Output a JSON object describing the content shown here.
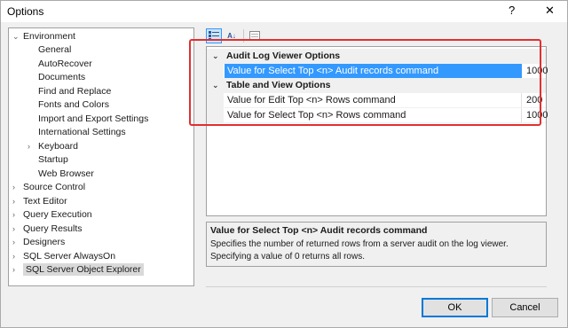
{
  "window": {
    "title": "Options",
    "help_glyph": "?",
    "close_glyph": "✕"
  },
  "tree": {
    "items": [
      {
        "label": "Environment",
        "glyph": "⌄"
      },
      {
        "label": "General",
        "glyph": ""
      },
      {
        "label": "AutoRecover",
        "glyph": ""
      },
      {
        "label": "Documents",
        "glyph": ""
      },
      {
        "label": "Find and Replace",
        "glyph": ""
      },
      {
        "label": "Fonts and Colors",
        "glyph": ""
      },
      {
        "label": "Import and Export Settings",
        "glyph": ""
      },
      {
        "label": "International Settings",
        "glyph": ""
      },
      {
        "label": "Keyboard",
        "glyph": "›"
      },
      {
        "label": "Startup",
        "glyph": ""
      },
      {
        "label": "Web Browser",
        "glyph": ""
      },
      {
        "label": "Source Control",
        "glyph": "›"
      },
      {
        "label": "Text Editor",
        "glyph": "›"
      },
      {
        "label": "Query Execution",
        "glyph": "›"
      },
      {
        "label": "Query Results",
        "glyph": "›"
      },
      {
        "label": "Designers",
        "glyph": "›"
      },
      {
        "label": "SQL Server AlwaysOn",
        "glyph": "›"
      },
      {
        "label": "SQL Server Object Explorer",
        "glyph": "›"
      }
    ]
  },
  "toolbar": {
    "categorized_icon": "categorized-icon",
    "alphabetical_icon": "sort-alphabetical-icon",
    "property_pages_icon": "property-pages-icon",
    "alpha_glyph": "A↓"
  },
  "grid": {
    "categories": [
      {
        "label": "Audit Log Viewer Options",
        "chevron": "⌄",
        "rows": [
          {
            "name": "Value for Select Top <n> Audit records command",
            "value": "1000"
          }
        ]
      },
      {
        "label": "Table and View Options",
        "chevron": "⌄",
        "rows": [
          {
            "name": "Value for Edit Top <n> Rows command",
            "value": "200"
          },
          {
            "name": "Value for Select Top <n> Rows command",
            "value": "1000"
          }
        ]
      }
    ]
  },
  "description": {
    "title": "Value for Select Top <n> Audit records command",
    "body": "Specifies the number of returned rows from a server audit on the log viewer. Specifying a value of 0 returns all rows."
  },
  "buttons": {
    "ok": "OK",
    "cancel": "Cancel"
  },
  "colors": {
    "selection": "#3399ff",
    "highlight_box": "#e03030",
    "default_button_border": "#0078d7"
  }
}
